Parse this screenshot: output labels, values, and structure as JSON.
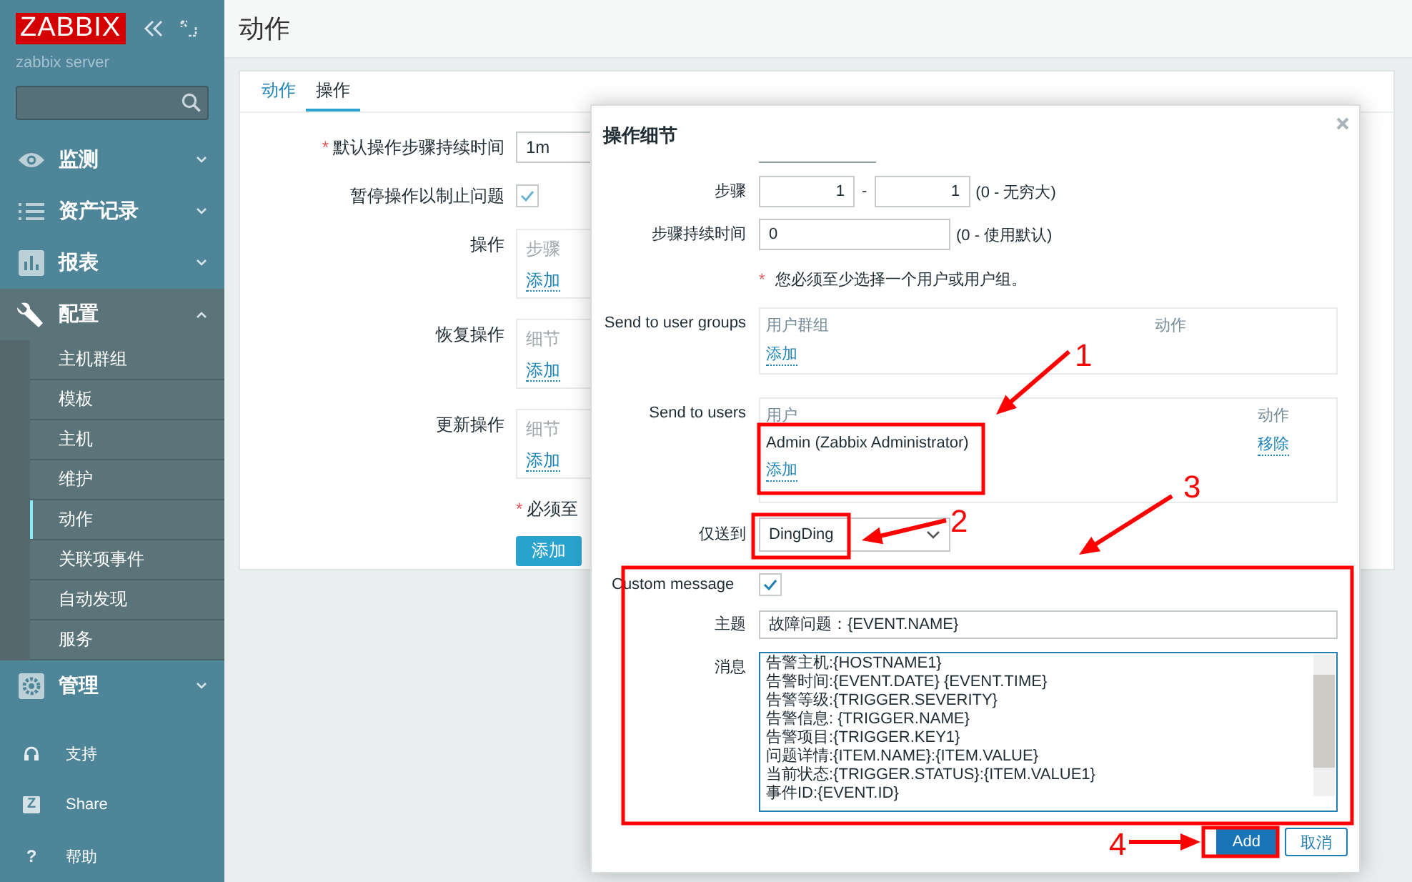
{
  "sidebar": {
    "logo": "ZABBIX",
    "server_name": "zabbix server",
    "menu": [
      {
        "label": "监测",
        "expanded": false
      },
      {
        "label": "资产记录",
        "expanded": false
      },
      {
        "label": "报表",
        "expanded": false
      },
      {
        "label": "配置",
        "expanded": true,
        "children": [
          {
            "label": "主机群组",
            "selected": false
          },
          {
            "label": "模板",
            "selected": false
          },
          {
            "label": "主机",
            "selected": false
          },
          {
            "label": "维护",
            "selected": false
          },
          {
            "label": "动作",
            "selected": true
          },
          {
            "label": "关联项事件",
            "selected": false
          },
          {
            "label": "自动发现",
            "selected": false
          },
          {
            "label": "服务",
            "selected": false
          }
        ]
      },
      {
        "label": "管理",
        "expanded": false
      }
    ],
    "footer_links": [
      {
        "label": "支持"
      },
      {
        "label": "Share",
        "icon_text": "Z"
      },
      {
        "label": "帮助",
        "icon_text": "?"
      }
    ]
  },
  "page_title": "动作",
  "tabs": [
    {
      "label": "动作",
      "selected": false
    },
    {
      "label": "操作",
      "selected": true
    }
  ],
  "form": {
    "rows": [
      {
        "kind": "input",
        "mark": "*",
        "label": "默认操作步骤持续时间",
        "value": "1m"
      },
      {
        "kind": "checkbox",
        "label": "暂停操作以制止问题",
        "checked": true
      },
      {
        "kind": "list",
        "label": "操作",
        "header": "步骤",
        "link": "添加"
      },
      {
        "kind": "list",
        "label": "恢复操作",
        "header": "细节",
        "link": "添加"
      },
      {
        "kind": "list",
        "label": "更新操作",
        "header": "细节",
        "link": "添加"
      }
    ],
    "note_mark": "*",
    "note": "必须至",
    "submit": "添加"
  },
  "dialog": {
    "title": "操作细节",
    "steps": {
      "label": "步骤",
      "from": "1",
      "separator": "-",
      "to": "1",
      "hint": "(0 - 无穷大)"
    },
    "step_duration": {
      "label": "步骤持续时间",
      "value": "0",
      "hint": "(0 - 使用默认)"
    },
    "note_mark": "*",
    "note": "您必须至少选择一个用户或用户组。",
    "user_groups": {
      "label": "Send to user groups",
      "columns": [
        "用户群组",
        "动作"
      ],
      "link": "添加"
    },
    "users": {
      "label": "Send to users",
      "columns": [
        "用户",
        "动作"
      ],
      "rows": [
        {
          "name": "Admin (Zabbix Administrator)",
          "action": "移除"
        }
      ],
      "link": "添加"
    },
    "send_only_to": {
      "label": "仅送到",
      "value": "DingDing"
    },
    "custom_message": {
      "label": "Custom message",
      "checked": true
    },
    "subject": {
      "label": "主题",
      "value": "故障问题：{EVENT.NAME}"
    },
    "message": {
      "label": "消息",
      "lines": [
        "告警主机:{HOSTNAME1}",
        "告警时间:{EVENT.DATE} {EVENT.TIME}",
        "告警等级:{TRIGGER.SEVERITY}",
        "告警信息: {TRIGGER.NAME}",
        "告警项目:{TRIGGER.KEY1}",
        "问题详情:{ITEM.NAME}:{ITEM.VALUE}",
        "当前状态:{TRIGGER.STATUS}:{ITEM.VALUE1}",
        "事件ID:{EVENT.ID}"
      ]
    },
    "buttons": [
      {
        "label": "Add",
        "kind": "primary"
      },
      {
        "label": "取消",
        "kind": "secondary"
      }
    ]
  },
  "annotations": [
    {
      "number": "1"
    },
    {
      "number": "2"
    },
    {
      "number": "3"
    },
    {
      "number": "4"
    }
  ]
}
